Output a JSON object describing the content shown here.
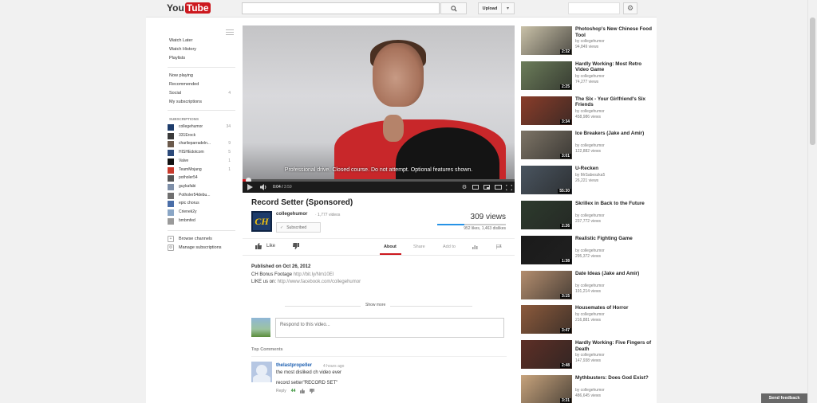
{
  "header": {
    "logo_you": "You",
    "logo_tube": "Tube",
    "upload_label": "Upload"
  },
  "guide": {
    "top_items": [
      "Watch Later",
      "Watch History",
      "Playlists"
    ],
    "mid_items": [
      {
        "label": "Now playing",
        "count": ""
      },
      {
        "label": "Recommended",
        "count": ""
      },
      {
        "label": "Social",
        "count": "4"
      },
      {
        "label": "My subscriptions",
        "count": ""
      }
    ],
    "subscriptions_heading": "SUBSCRIPTIONS",
    "subscriptions": [
      {
        "name": "collegehumor",
        "count": "34",
        "color": "#1d3c6b"
      },
      {
        "name": "331Erock",
        "count": "",
        "color": "#3a3a3a"
      },
      {
        "name": "charlieparradeln...",
        "count": "9",
        "color": "#6b5a4c"
      },
      {
        "name": "HISHEdotcom",
        "count": "5",
        "color": "#2c4a7a"
      },
      {
        "name": "Valve",
        "count": "1",
        "color": "#111111"
      },
      {
        "name": "TeamMojang",
        "count": "1",
        "color": "#c83a2c"
      },
      {
        "name": "potholer54",
        "count": "",
        "color": "#555555"
      },
      {
        "name": "guykafabi",
        "count": "",
        "color": "#7e8fa8"
      },
      {
        "name": "Potholer54debu...",
        "count": "",
        "color": "#6f6f6f"
      },
      {
        "name": "epic chorus",
        "count": "",
        "color": "#4a6ea8"
      },
      {
        "name": "Crienek2y",
        "count": "",
        "color": "#8aa6c6"
      },
      {
        "name": "bmbmfed",
        "count": "",
        "color": "#9a9a9a"
      }
    ],
    "footer_items": [
      "Browse channels",
      "Manage subscriptions"
    ]
  },
  "player": {
    "caption": "Professional drive. Closed course. Do not attempt. Optional features shown.",
    "time_current": "0:04",
    "time_total": "3:59",
    "progress": 0.02
  },
  "video": {
    "title": "Record Setter (Sponsored)",
    "channel_logo_text": "CH",
    "channel": "collegehumor",
    "channel_videos": "· 1,777 videos",
    "subscribed_label": "Subscribed",
    "views": "309 views",
    "likes_text": "952 likes, 1,463 dislikes",
    "like_ratio": 0.39,
    "like_label": "Like",
    "tabs": [
      "About",
      "Share",
      "Add to"
    ],
    "published": "Published on Oct 26, 2012",
    "desc_line1_prefix": "CH Bonus Footage ",
    "desc_line1_link": "http://bit.ly/Nm10El",
    "desc_line2_prefix": "LIKE us on: ",
    "desc_line2_link": "http://www.facebook.com/collegehumor",
    "show_more": "Show more"
  },
  "comments": {
    "placeholder": "Respond to this video...",
    "heading": "Top Comments",
    "items": [
      {
        "user": "thelastpropeller",
        "time": "4 hours ago",
        "line1": "the most disliked ch video ever",
        "line2": "record setter\"RECORD SET\"",
        "reply": "Reply",
        "likes": "44"
      }
    ]
  },
  "related": [
    {
      "title": "Photoshop's New Chinese Food Tool",
      "by": "by collegehumor",
      "views": "94,849 views",
      "duration": "2:32",
      "bg": "#c9c1a8"
    },
    {
      "title": "Hardly Working: Most Retro Video Game",
      "by": "by collegehumor",
      "views": "74,277 views",
      "duration": "2:25",
      "bg": "#6c7d5a"
    },
    {
      "title": "The Six - Your Girlfriend's Six Friends",
      "by": "by collegehumor",
      "views": "458,986 views",
      "duration": "3:34",
      "bg": "#8a3d2a"
    },
    {
      "title": "Ice Breakers (Jake and Amir)",
      "by": "by collegehumor",
      "views": "122,882 views",
      "duration": "3:01",
      "bg": "#7d7466"
    },
    {
      "title": "U-Recken",
      "by": "by MrSabeszka5",
      "views": "26,221 views",
      "duration": "55:30",
      "bg": "#4a5560"
    },
    {
      "title": "Skrillex in Back to the Future",
      "by": "by collegehumor",
      "views": "237,772 views",
      "duration": "2:26",
      "bg": "#2d3b2d"
    },
    {
      "title": "Realistic Fighting Game",
      "by": "by collegehumor",
      "views": "295,372 views",
      "duration": "1:38",
      "bg": "#1a1a1a"
    },
    {
      "title": "Date Ideas (Jake and Amir)",
      "by": "by collegehumor",
      "views": "191,214 views",
      "duration": "3:15",
      "bg": "#b38d6e"
    },
    {
      "title": "Housemates of Horror",
      "by": "by collegehumor",
      "views": "216,881 views",
      "duration": "3:47",
      "bg": "#8c5a3c"
    },
    {
      "title": "Hardly Working: Five Fingers of Death",
      "by": "by collegehumor",
      "views": "147,938 views",
      "duration": "2:48",
      "bg": "#5e2f26"
    },
    {
      "title": "Mythbusters: Does God Exist?",
      "by": "by collegehumor",
      "views": "486,645 views",
      "duration": "3:31",
      "bg": "#c7a37c"
    }
  ],
  "feedback_label": "Send feedback",
  "colors": {
    "brand_red": "#cc181e",
    "link_blue": "#1b5eb0",
    "like_blue": "#2793e6"
  }
}
